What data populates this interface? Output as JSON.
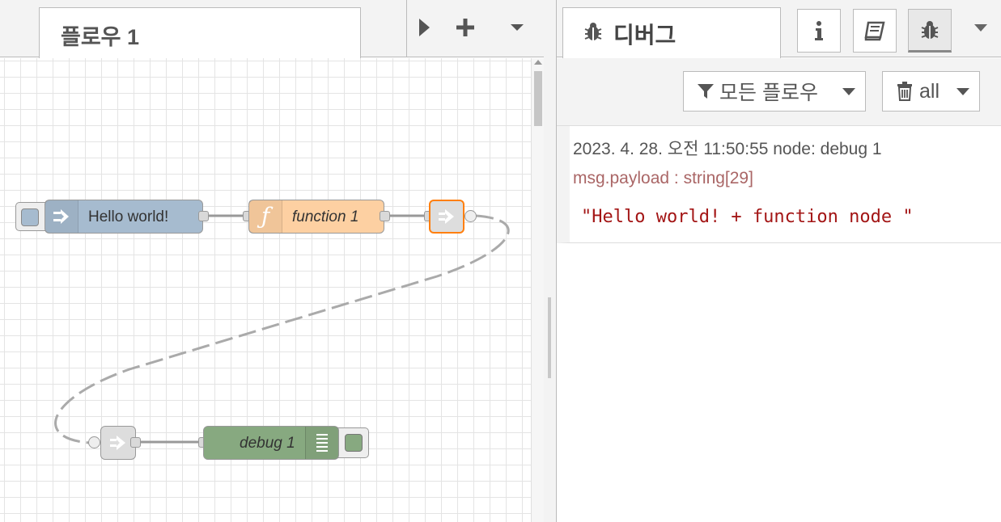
{
  "workspace": {
    "tab_label": "플로우 1",
    "toolbar_icons": [
      "play-icon",
      "plus-icon",
      "chevron-down-icon"
    ]
  },
  "flow_nodes": {
    "inject": {
      "label": "Hello world!",
      "color": "#a6bbcf",
      "icon": "arrow-in-icon"
    },
    "function": {
      "label": "function 1",
      "color": "#fdd0a2",
      "icon": "function-icon"
    },
    "link_out": {
      "color": "#dddddd",
      "icon": "link-out-icon",
      "selected_border": "#ff7f0e"
    },
    "link_in": {
      "color": "#dddddd",
      "icon": "link-in-icon"
    },
    "debug": {
      "label": "debug 1",
      "color": "#87a980",
      "icon": "list-icon"
    }
  },
  "sidebar": {
    "tab_label": "디버그",
    "buttons": [
      "info-icon",
      "book-icon",
      "bug-icon"
    ],
    "filter_label": "모든 플로우",
    "clear_label": "all"
  },
  "debug_messages": [
    {
      "meta": "2023. 4. 28. 오전 11:50:55   node: debug 1",
      "topic": "msg.payload : string[29]",
      "value": "\"Hello world! + function node \""
    }
  ]
}
